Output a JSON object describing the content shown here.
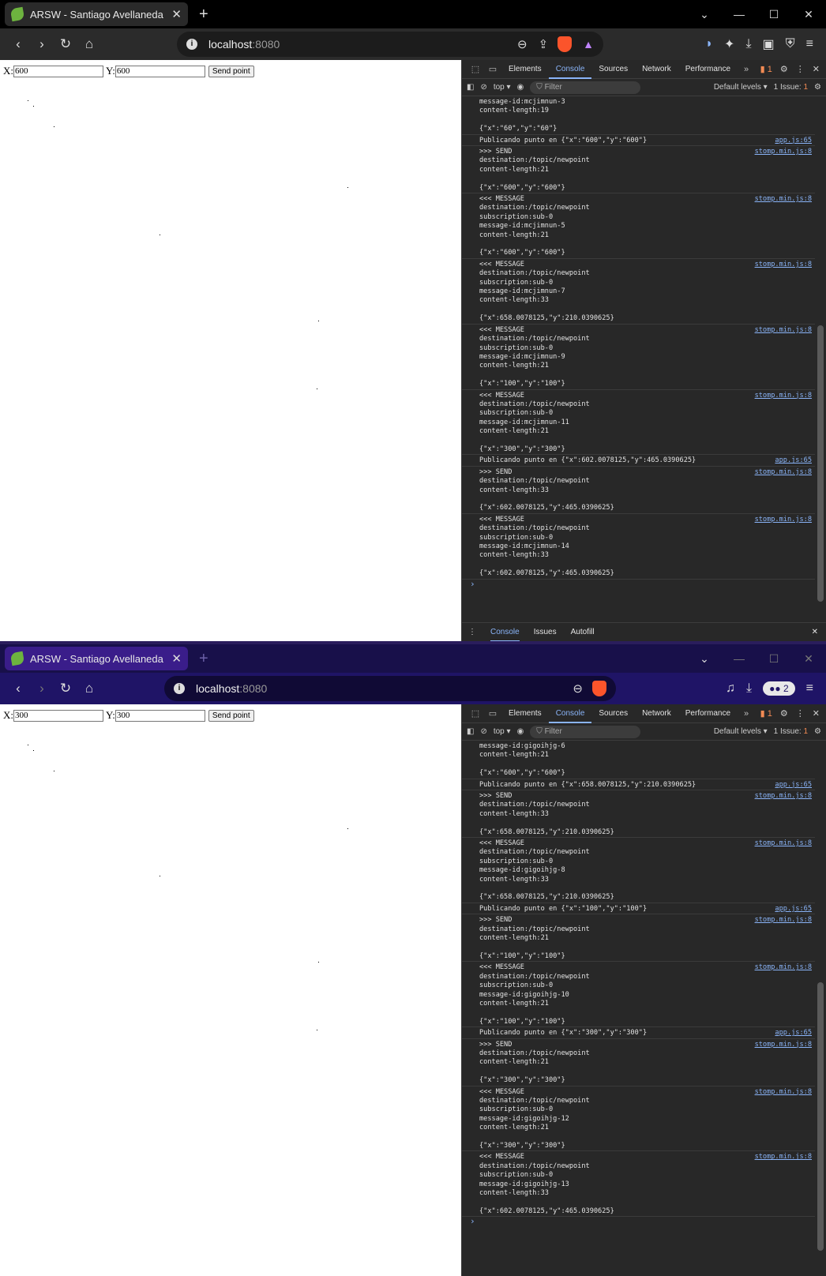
{
  "window1": {
    "tab_title": "ARSW - Santiago Avellaneda ar",
    "url_host": "localhost",
    "url_port": ":8080",
    "form": {
      "x_label": "X:",
      "x_value": "600",
      "y_label": "Y:",
      "y_value": "600",
      "send_label": "Send point"
    },
    "devtools": {
      "tabs": [
        "Elements",
        "Console",
        "Sources",
        "Network",
        "Performance"
      ],
      "issues_badge": "1",
      "context": "top",
      "filter_placeholder": "Filter",
      "levels": "Default levels",
      "issue_text": "1 Issue:",
      "issue_count": "1",
      "drawer_tabs": [
        "Console",
        "Issues",
        "Autofill"
      ],
      "log": [
        {
          "src": "",
          "lines": [
            "message-id:mcjimnun-3",
            "content-length:19",
            "",
            "{\"x\":\"60\",\"y\":\"60\"}"
          ]
        },
        {
          "src": "app.js:65",
          "lines": [
            "Publicando punto en {\"x\":\"600\",\"y\":\"600\"}"
          ]
        },
        {
          "src": "stomp.min.js:8",
          "lines": [
            ">>> SEND",
            "destination:/topic/newpoint",
            "content-length:21",
            "",
            "{\"x\":\"600\",\"y\":\"600\"}"
          ]
        },
        {
          "src": "stomp.min.js:8",
          "lines": [
            "<<< MESSAGE",
            "destination:/topic/newpoint",
            "subscription:sub-0",
            "message-id:mcjimnun-5",
            "content-length:21",
            "",
            "{\"x\":\"600\",\"y\":\"600\"}"
          ]
        },
        {
          "src": "stomp.min.js:8",
          "lines": [
            "<<< MESSAGE",
            "destination:/topic/newpoint",
            "subscription:sub-0",
            "message-id:mcjimnun-7",
            "content-length:33",
            "",
            "{\"x\":658.0078125,\"y\":210.0390625}"
          ]
        },
        {
          "src": "stomp.min.js:8",
          "lines": [
            "<<< MESSAGE",
            "destination:/topic/newpoint",
            "subscription:sub-0",
            "message-id:mcjimnun-9",
            "content-length:21",
            "",
            "{\"x\":\"100\",\"y\":\"100\"}"
          ]
        },
        {
          "src": "stomp.min.js:8",
          "lines": [
            "<<< MESSAGE",
            "destination:/topic/newpoint",
            "subscription:sub-0",
            "message-id:mcjimnun-11",
            "content-length:21",
            "",
            "{\"x\":\"300\",\"y\":\"300\"}"
          ]
        },
        {
          "src": "app.js:65",
          "lines": [
            "Publicando punto en {\"x\":602.0078125,\"y\":465.0390625}"
          ]
        },
        {
          "src": "stomp.min.js:8",
          "lines": [
            ">>> SEND",
            "destination:/topic/newpoint",
            "content-length:33",
            "",
            "{\"x\":602.0078125,\"y\":465.0390625}"
          ]
        },
        {
          "src": "stomp.min.js:8",
          "lines": [
            "<<< MESSAGE",
            "destination:/topic/newpoint",
            "subscription:sub-0",
            "message-id:mcjimnun-14",
            "content-length:33",
            "",
            "{\"x\":602.0078125,\"y\":465.0390625}"
          ]
        }
      ]
    }
  },
  "window2": {
    "tab_title": "ARSW - Santiago Avellaneda ar",
    "url_host": "localhost",
    "url_port": ":8080",
    "private_badge": "2",
    "form": {
      "x_label": "X:",
      "x_value": "300",
      "y_label": "Y:",
      "y_value": "300",
      "send_label": "Send point"
    },
    "devtools": {
      "tabs": [
        "Elements",
        "Console",
        "Sources",
        "Network",
        "Performance"
      ],
      "issues_badge": "1",
      "context": "top",
      "filter_placeholder": "Filter",
      "levels": "Default levels",
      "issue_text": "1 Issue:",
      "issue_count": "1",
      "log": [
        {
          "src": "",
          "lines": [
            "message-id:gigoihjg-6",
            "content-length:21",
            "",
            "{\"x\":\"600\",\"y\":\"600\"}"
          ]
        },
        {
          "src": "app.js:65",
          "lines": [
            "Publicando punto en {\"x\":658.0078125,\"y\":210.0390625}"
          ]
        },
        {
          "src": "stomp.min.js:8",
          "lines": [
            ">>> SEND",
            "destination:/topic/newpoint",
            "content-length:33",
            "",
            "{\"x\":658.0078125,\"y\":210.0390625}"
          ]
        },
        {
          "src": "stomp.min.js:8",
          "lines": [
            "<<< MESSAGE",
            "destination:/topic/newpoint",
            "subscription:sub-0",
            "message-id:gigoihjg-8",
            "content-length:33",
            "",
            "{\"x\":658.0078125,\"y\":210.0390625}"
          ]
        },
        {
          "src": "app.js:65",
          "lines": [
            "Publicando punto en {\"x\":\"100\",\"y\":\"100\"}"
          ]
        },
        {
          "src": "stomp.min.js:8",
          "lines": [
            ">>> SEND",
            "destination:/topic/newpoint",
            "content-length:21",
            "",
            "{\"x\":\"100\",\"y\":\"100\"}"
          ]
        },
        {
          "src": "stomp.min.js:8",
          "lines": [
            "<<< MESSAGE",
            "destination:/topic/newpoint",
            "subscription:sub-0",
            "message-id:gigoihjg-10",
            "content-length:21",
            "",
            "{\"x\":\"100\",\"y\":\"100\"}"
          ]
        },
        {
          "src": "app.js:65",
          "lines": [
            "Publicando punto en {\"x\":\"300\",\"y\":\"300\"}"
          ]
        },
        {
          "src": "stomp.min.js:8",
          "lines": [
            ">>> SEND",
            "destination:/topic/newpoint",
            "content-length:21",
            "",
            "{\"x\":\"300\",\"y\":\"300\"}"
          ]
        },
        {
          "src": "stomp.min.js:8",
          "lines": [
            "<<< MESSAGE",
            "destination:/topic/newpoint",
            "subscription:sub-0",
            "message-id:gigoihjg-12",
            "content-length:21",
            "",
            "{\"x\":\"300\",\"y\":\"300\"}"
          ]
        },
        {
          "src": "stomp.min.js:8",
          "lines": [
            "<<< MESSAGE",
            "destination:/topic/newpoint",
            "subscription:sub-0",
            "message-id:gigoihjg-13",
            "content-length:33",
            "",
            "{\"x\":602.0078125,\"y\":465.0390625}"
          ]
        }
      ]
    }
  }
}
